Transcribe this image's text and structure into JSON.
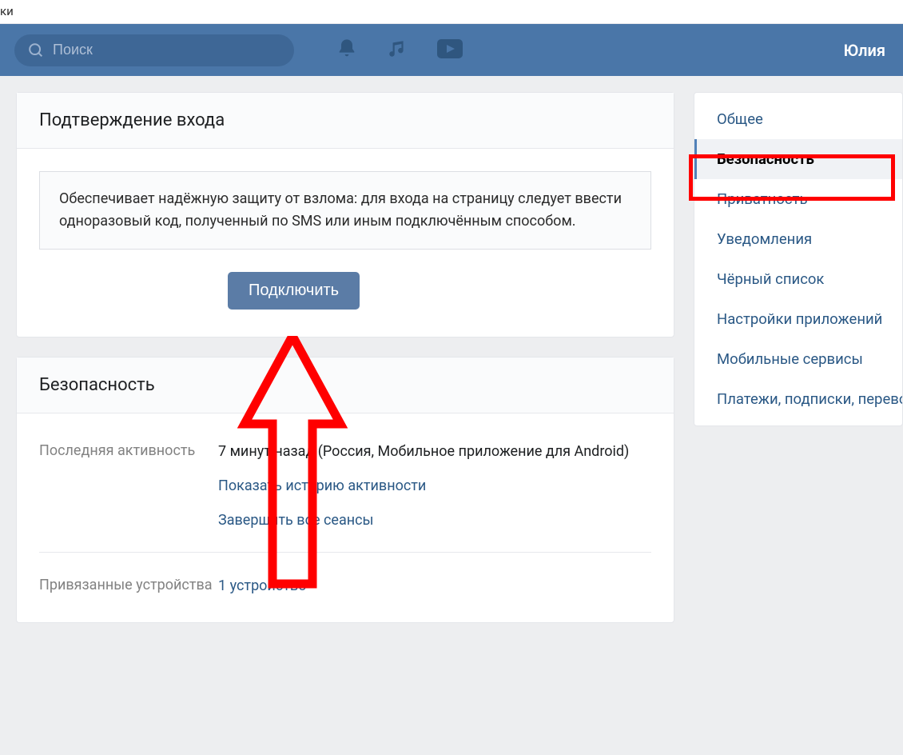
{
  "toptab_text": "ки",
  "search": {
    "placeholder": "Поиск"
  },
  "user_name": "Юлия",
  "confirm_card": {
    "title": "Подтверждение входа",
    "info": "Обеспечивает надёжную защиту от взлома: для входа на страницу следует ввести одноразовый код, полученный по SMS или иным подключённым способом.",
    "button": "Подключить"
  },
  "security_card": {
    "title": "Безопасность",
    "last_activity_label": "Последняя активность",
    "last_activity_value": "7 минут назад (Россия, Мобильное приложение для Android)",
    "history_link": "Показать историю активности",
    "end_sessions_link": "Завершить все сеансы",
    "devices_label": "Привязанные устройства",
    "devices_value": "1 устройство"
  },
  "sidebar": {
    "items": [
      {
        "label": "Общее"
      },
      {
        "label": "Безопасность"
      },
      {
        "label": "Приватность"
      },
      {
        "label": "Уведомления"
      },
      {
        "label": "Чёрный список"
      },
      {
        "label": "Настройки приложений"
      },
      {
        "label": "Мобильные сервисы"
      },
      {
        "label": "Платежи, подписки, переводы"
      }
    ]
  }
}
